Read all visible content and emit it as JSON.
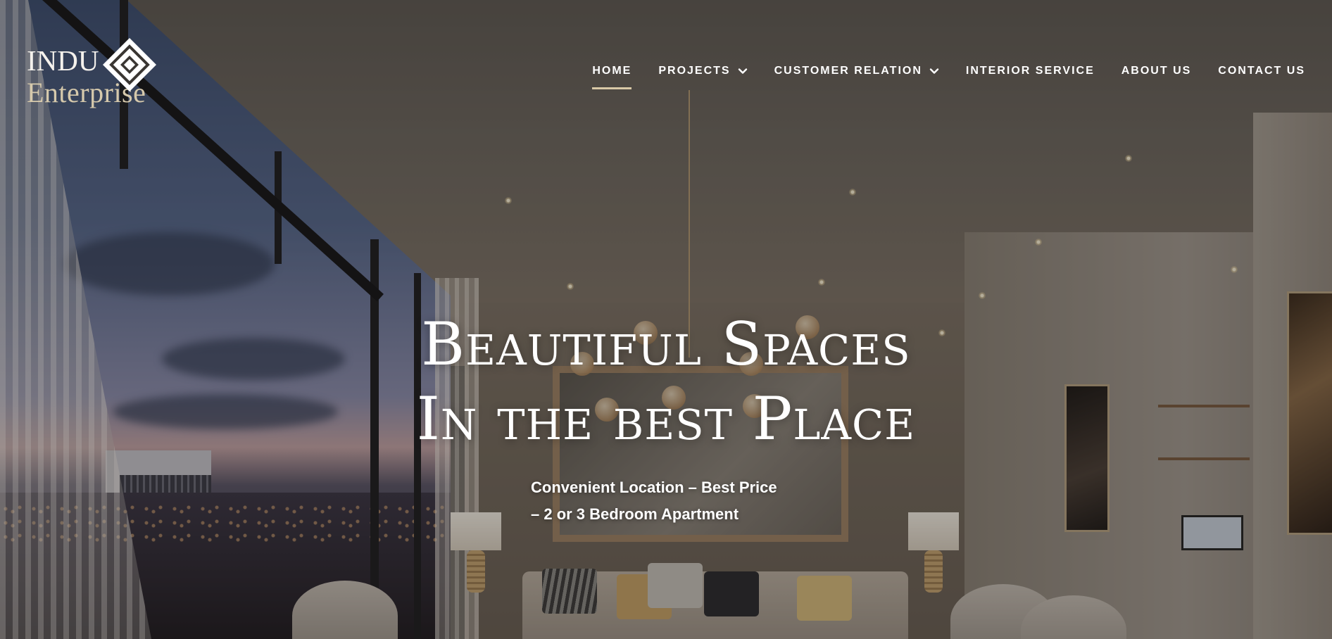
{
  "brand": {
    "line1": "INDU",
    "line2": "Enterprise"
  },
  "nav": {
    "items": [
      {
        "label": "HOME",
        "active": true,
        "has_dropdown": false
      },
      {
        "label": "PROJECTS",
        "active": false,
        "has_dropdown": true
      },
      {
        "label": "CUSTOMER RELATION",
        "active": false,
        "has_dropdown": true
      },
      {
        "label": "INTERIOR SERVICE",
        "active": false,
        "has_dropdown": false
      },
      {
        "label": "ABOUT US",
        "active": false,
        "has_dropdown": false
      },
      {
        "label": "CONTACT US",
        "active": false,
        "has_dropdown": false
      }
    ],
    "active_underline_color": "#d8c8a6"
  },
  "hero": {
    "headline_line1": "Beautiful Spaces",
    "headline_line2": "In the best Place",
    "sub_line1": "Convenient Location – Best Price",
    "sub_line2": "– 2 or 3 Bedroom Apartment"
  },
  "colors": {
    "text": "#ffffff",
    "logo_gold": "#d6c9ac",
    "accent": "#d8c8a6"
  }
}
